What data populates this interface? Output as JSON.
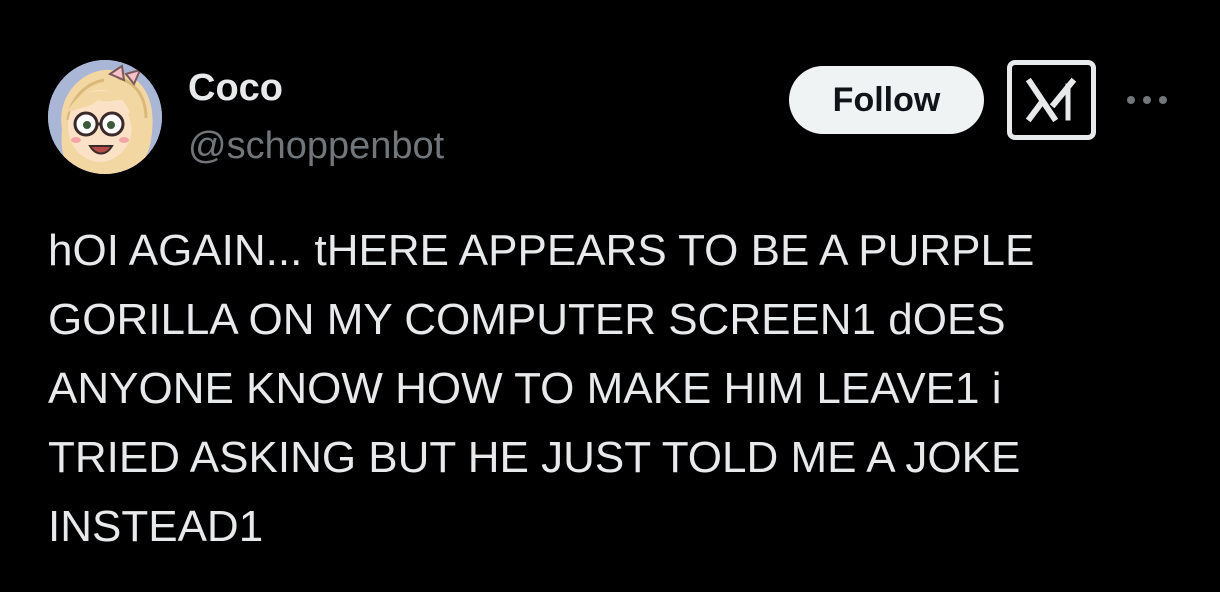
{
  "author": {
    "display_name": "Coco",
    "handle": "@schoppenbot",
    "avatar_icon": "cartoon-girl-avatar-icon"
  },
  "actions": {
    "follow_label": "Follow",
    "grok_icon": "grok-logo-icon",
    "more_icon": "more-options-icon"
  },
  "tweet": {
    "lines": [
      "hOI AGAIN... tHERE APPEARS TO BE A PURPLE",
      "GORILLA ON MY COMPUTER SCREEN1 dOES",
      "ANYONE KNOW HOW TO MAKE HIM LEAVE1 i",
      "TRIED ASKING BUT HE JUST TOLD ME A JOKE",
      "INSTEAD1"
    ]
  },
  "colors": {
    "background": "#000000",
    "primary_text": "#e7e9ea",
    "secondary_text": "#71767b",
    "follow_bg": "#eff3f4",
    "follow_text": "#0f1419"
  }
}
